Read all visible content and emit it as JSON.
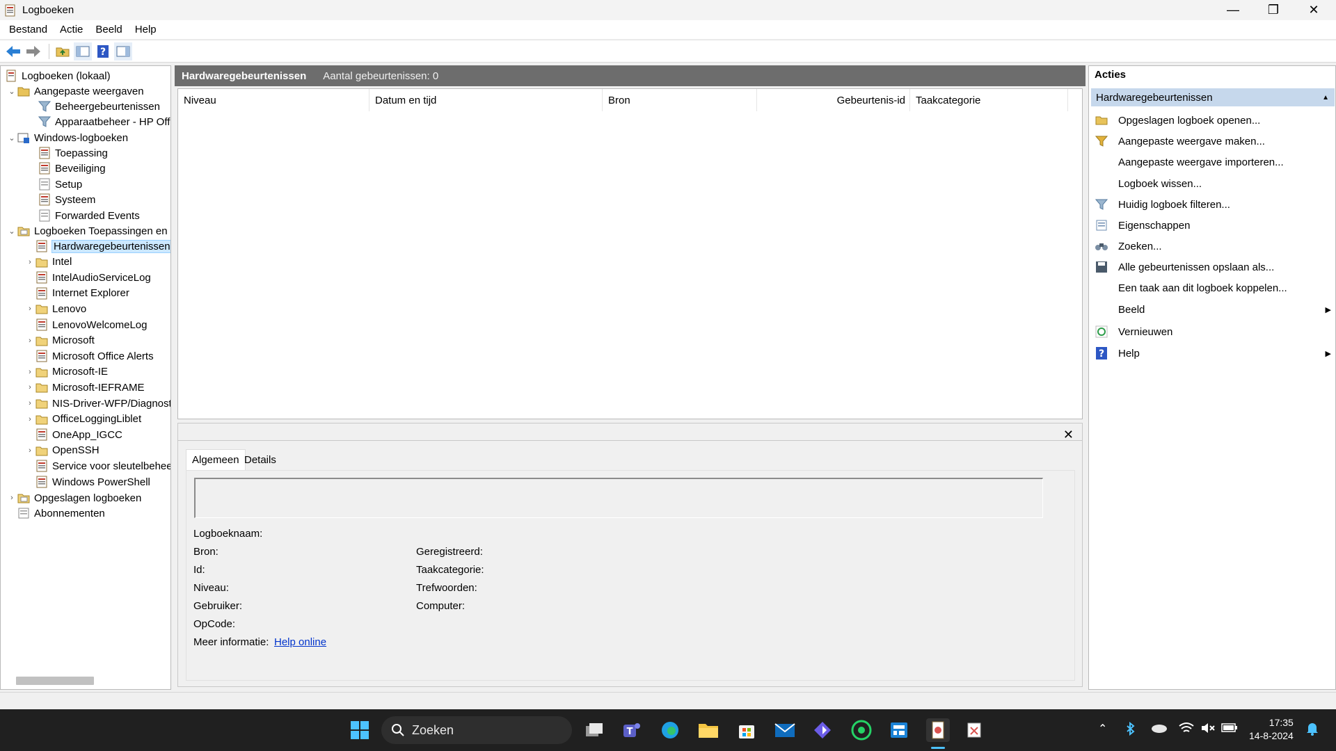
{
  "window": {
    "title": "Logboeken",
    "controls": {
      "minimize": "—",
      "restore": "❐",
      "close": "✕"
    }
  },
  "menu": [
    "Bestand",
    "Actie",
    "Beeld",
    "Help"
  ],
  "tree": {
    "root": "Logboeken (lokaal)",
    "custom_views": "Aangepaste weergaven",
    "admin_events": "Beheergebeurtenissen",
    "device_mgmt": "Apparaatbeheer - HP Offi",
    "windows_logs": "Windows-logboeken",
    "application": "Toepassing",
    "security": "Beveiliging",
    "setup": "Setup",
    "system": "Systeem",
    "forwarded": "Forwarded Events",
    "apps_services": "Logboeken Toepassingen en",
    "items": [
      "Hardwaregebeurtenissen",
      "Intel",
      "IntelAudioServiceLog",
      "Internet Explorer",
      "Lenovo",
      "LenovoWelcomeLog",
      "Microsoft",
      "Microsoft Office Alerts",
      "Microsoft-IE",
      "Microsoft-IEFRAME",
      "NIS-Driver-WFP/Diagnost",
      "OfficeLoggingLiblet",
      "OneApp_IGCC",
      "OpenSSH",
      "Service voor sleutelbehee",
      "Windows PowerShell"
    ],
    "saved_logs": "Opgeslagen logboeken",
    "subscriptions": "Abonnementen"
  },
  "center": {
    "title": "Hardwaregebeurtenissen",
    "count": "Aantal gebeurtenissen: 0",
    "columns": [
      "Niveau",
      "Datum en tijd",
      "Bron",
      "Gebeurtenis-id",
      "Taakcategorie"
    ]
  },
  "detail": {
    "close": "✕",
    "tabs": [
      "Algemeen",
      "Details"
    ],
    "labels": {
      "log_name": "Logboeknaam:",
      "source": "Bron:",
      "id": "Id:",
      "level": "Niveau:",
      "user": "Gebruiker:",
      "opcode": "OpCode:",
      "more_info": "Meer informatie:",
      "logged": "Geregistreerd:",
      "task_category": "Taakcategorie:",
      "keywords": "Trefwoorden:",
      "computer": "Computer:"
    },
    "help_link": "Help online"
  },
  "actions": {
    "title": "Acties",
    "section": "Hardwaregebeurtenissen",
    "items": [
      "Opgeslagen logboek openen...",
      "Aangepaste weergave maken...",
      "Aangepaste weergave importeren...",
      "Logboek wissen...",
      "Huidig logboek filteren...",
      "Eigenschappen",
      "Zoeken...",
      "Alle gebeurtenissen opslaan als...",
      "Een taak aan dit logboek koppelen...",
      "Beeld",
      "Vernieuwen",
      "Help"
    ]
  },
  "taskbar": {
    "search_placeholder": "Zoeken",
    "time": "17:35",
    "date": "14-8-2024"
  }
}
